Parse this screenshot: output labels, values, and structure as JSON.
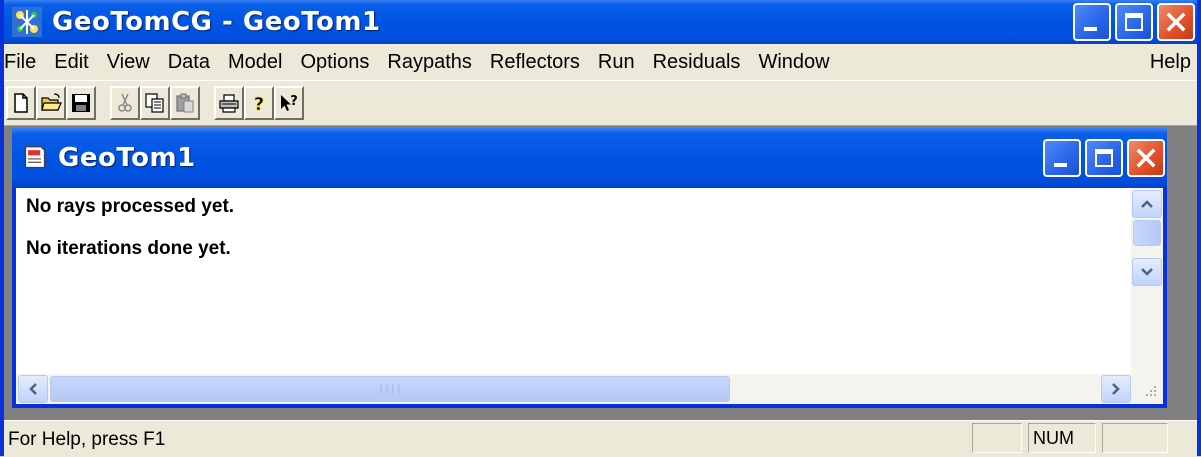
{
  "app": {
    "title": "GeoTomCG - GeoTom1",
    "icon": "geotom-app-icon"
  },
  "menu": {
    "items": [
      "File",
      "Edit",
      "View",
      "Data",
      "Model",
      "Options",
      "Raypaths",
      "Reflectors",
      "Run",
      "Residuals",
      "Window",
      "Help"
    ]
  },
  "toolbar": {
    "buttons": [
      {
        "icon": "new-document-icon",
        "enabled": true
      },
      {
        "icon": "open-folder-icon",
        "enabled": true
      },
      {
        "icon": "save-floppy-icon",
        "enabled": true
      },
      {
        "icon": "cut-scissors-icon",
        "enabled": false
      },
      {
        "icon": "copy-icon",
        "enabled": true
      },
      {
        "icon": "paste-icon",
        "enabled": false
      },
      {
        "icon": "print-icon",
        "enabled": true
      },
      {
        "icon": "about-question-icon",
        "enabled": true
      },
      {
        "icon": "context-help-icon",
        "enabled": true
      }
    ]
  },
  "child_window": {
    "title": "GeoTom1",
    "icon": "document-icon",
    "lines": [
      "No rays processed yet.",
      "No iterations done yet."
    ]
  },
  "status": {
    "message": "For Help, press F1",
    "num_indicator": "NUM"
  },
  "colors": {
    "titlebar_blue": "#0054e3",
    "close_red": "#e0502a",
    "face": "#ece9d8",
    "mdi_background": "#808080"
  }
}
